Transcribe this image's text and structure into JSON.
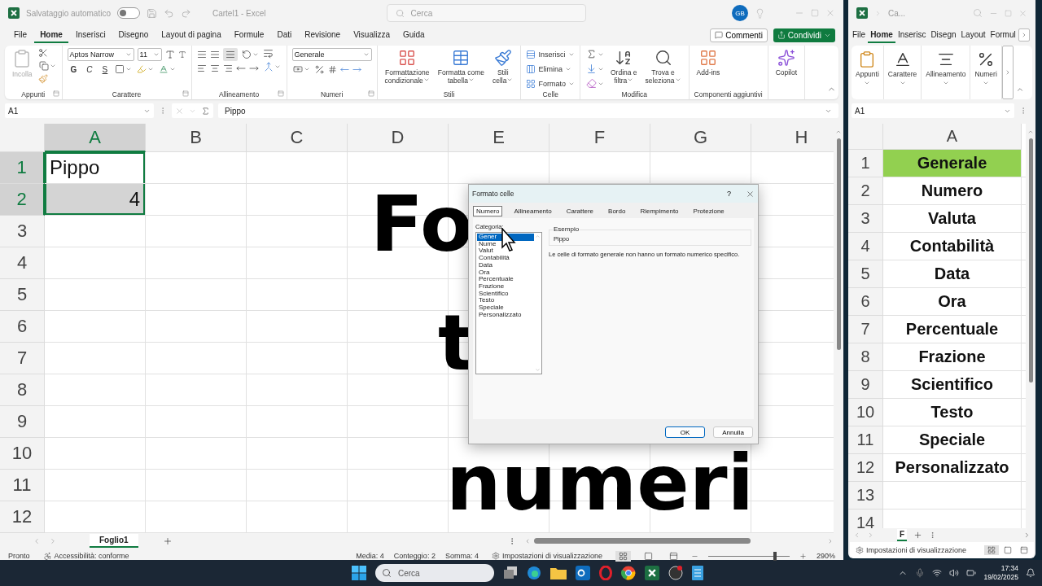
{
  "main_window": {
    "title_bar": {
      "autosave": {
        "label": "Salvataggio automatico",
        "on": false
      },
      "title": "Cartel1 - Excel",
      "search": {
        "placeholder": "Cerca"
      },
      "avatar": "GB"
    },
    "ribbon_tabs": [
      {
        "label": "File",
        "selected": false
      },
      {
        "label": "Home",
        "selected": true
      },
      {
        "label": "Inserisci",
        "selected": false
      },
      {
        "label": "Disegno",
        "selected": false
      },
      {
        "label": "Layout di pagina",
        "selected": false
      },
      {
        "label": "Formule",
        "selected": false
      },
      {
        "label": "Dati",
        "selected": false
      },
      {
        "label": "Revisione",
        "selected": false
      },
      {
        "label": "Visualizza",
        "selected": false
      },
      {
        "label": "Guida",
        "selected": false
      }
    ],
    "comments_button": "Commenti",
    "share_button": "Condividi",
    "ribbon_groups": [
      {
        "kind": "clipboard",
        "label": "Appunti",
        "paste": "Incolla"
      },
      {
        "kind": "font",
        "label": "Carattere",
        "font": "Aptos Narrow",
        "size": "11",
        "styles": [
          "G",
          "C",
          "S"
        ]
      },
      {
        "kind": "alignment",
        "label": "Allineamento"
      },
      {
        "kind": "number",
        "label": "Numeri",
        "format": "Generale"
      },
      {
        "kind": "menu_buttons",
        "label": "Stili",
        "buttons": [
          "Formattazione\ncondizionale",
          "Formatta come\ntabella",
          "Stili\ncella"
        ]
      },
      {
        "kind": "cells",
        "label": "Celle",
        "buttons": [
          "Inserisci",
          "Elimina",
          "Formato"
        ]
      },
      {
        "kind": "editing",
        "label": "Modifica",
        "buttons": [
          "Ordina e\nfiltra",
          "Trova e\nseleziona"
        ]
      },
      {
        "kind": "large",
        "label": "Componenti aggiuntivi",
        "buttons": [
          "Add-ins"
        ]
      },
      {
        "kind": "large",
        "buttons": [
          "Copilot"
        ]
      }
    ],
    "formula_bar": {
      "name_box": "A1",
      "content": "Pippo"
    },
    "columns": [
      {
        "label": "A",
        "selected": true
      },
      {
        "label": "B",
        "selected": false
      },
      {
        "label": "C",
        "selected": false
      },
      {
        "label": "D",
        "selected": false
      },
      {
        "label": "E",
        "selected": false
      },
      {
        "label": "F",
        "selected": false
      },
      {
        "label": "G",
        "selected": false
      },
      {
        "label": "H",
        "selected": false
      }
    ],
    "rows": [
      {
        "number": "1",
        "selected": true,
        "cells": [
          {
            "text": "Pippo",
            "kind": "text",
            "selected": true,
            "active": true
          }
        ]
      },
      {
        "number": "2",
        "selected": true,
        "cells": [
          {
            "text": "4",
            "kind": "number",
            "selected": true,
            "active": false
          }
        ]
      },
      {
        "number": "3",
        "selected": false
      },
      {
        "number": "4",
        "selected": false
      },
      {
        "number": "5",
        "selected": false
      },
      {
        "number": "6",
        "selected": false
      },
      {
        "number": "7",
        "selected": false
      },
      {
        "number": "8",
        "selected": false
      },
      {
        "number": "9",
        "selected": false
      },
      {
        "number": "10",
        "selected": false
      },
      {
        "number": "11",
        "selected": false
      },
      {
        "number": "12",
        "selected": false
      }
    ],
    "caption": [
      "Fo",
      "t",
      "numeri"
    ],
    "sheet_tabs": [
      {
        "label": "Foglio1",
        "selected": true
      }
    ],
    "status_bar": {
      "mode": "Pronto",
      "accessibility": "Accessibilità: conforme",
      "stats": [
        "Media: 4",
        "Conteggio: 2",
        "Somma: 4"
      ],
      "view_settings": "Impostazioni di visualizzazione",
      "zoom": {
        "level": 0.82,
        "label": "290%"
      }
    }
  },
  "dialog": {
    "title": "Formato celle",
    "help": "?",
    "tabs": [
      {
        "label": "Numero",
        "selected": true
      },
      {
        "label": "Allineamento",
        "selected": false
      },
      {
        "label": "Carattere",
        "selected": false
      },
      {
        "label": "Bordo",
        "selected": false
      },
      {
        "label": "Riempimento",
        "selected": false
      },
      {
        "label": "Protezione",
        "selected": false
      }
    ],
    "category_label": "Categoria:",
    "categories": [
      {
        "label": "Gener",
        "selected": true
      },
      {
        "label": "Nume",
        "selected": false
      },
      {
        "label": "Valut",
        "selected": false
      },
      {
        "label": "Contabilità",
        "selected": false
      },
      {
        "label": "Data",
        "selected": false
      },
      {
        "label": "Ora",
        "selected": false
      },
      {
        "label": "Percentuale",
        "selected": false
      },
      {
        "label": "Frazione",
        "selected": false
      },
      {
        "label": "Scientifico",
        "selected": false
      },
      {
        "label": "Testo",
        "selected": false
      },
      {
        "label": "Speciale",
        "selected": false
      },
      {
        "label": "Personalizzato",
        "selected": false
      }
    ],
    "sample_label": "Esempio",
    "sample_value": "Pippo",
    "description": "Le celle di formato generale non hanno un formato numerico specifico.",
    "buttons": [
      "OK",
      "Annulla"
    ]
  },
  "side_window": {
    "title": "Ca...",
    "ribbon_tabs": [
      {
        "label": "File",
        "selected": false
      },
      {
        "label": "Home",
        "selected": true
      },
      {
        "label": "Inserisc",
        "selected": false
      },
      {
        "label": "Disegn",
        "selected": false
      },
      {
        "label": "Layout",
        "selected": false
      },
      {
        "label": "Formul",
        "selected": false
      }
    ],
    "ribbon_groups": [
      "Appunti",
      "Carattere",
      "Allineamento",
      "Numeri"
    ],
    "name_box": "A1",
    "column": "A",
    "rows": [
      {
        "number": "1",
        "value": "Generale",
        "highlighted": true
      },
      {
        "number": "2",
        "value": "Numero",
        "highlighted": false
      },
      {
        "number": "3",
        "value": "Valuta",
        "highlighted": false
      },
      {
        "number": "4",
        "value": "Contabilità",
        "highlighted": false
      },
      {
        "number": "5",
        "value": "Data",
        "highlighted": false
      },
      {
        "number": "6",
        "value": "Ora",
        "highlighted": false
      },
      {
        "number": "7",
        "value": "Percentuale",
        "highlighted": false
      },
      {
        "number": "8",
        "value": "Frazione",
        "highlighted": false
      },
      {
        "number": "9",
        "value": "Scientifico",
        "highlighted": false
      },
      {
        "number": "10",
        "value": "Testo",
        "highlighted": false
      },
      {
        "number": "11",
        "value": "Speciale",
        "highlighted": false
      },
      {
        "number": "12",
        "value": "Personalizzato",
        "highlighted": false
      },
      {
        "number": "13",
        "highlighted": false
      },
      {
        "number": "14",
        "highlighted": false
      }
    ],
    "sheet_tab": "F",
    "view_settings": "Impostazioni di visualizzazione"
  },
  "taskbar": {
    "search": {
      "placeholder": "Cerca"
    },
    "time": "17:34",
    "date": "19/02/2025"
  }
}
